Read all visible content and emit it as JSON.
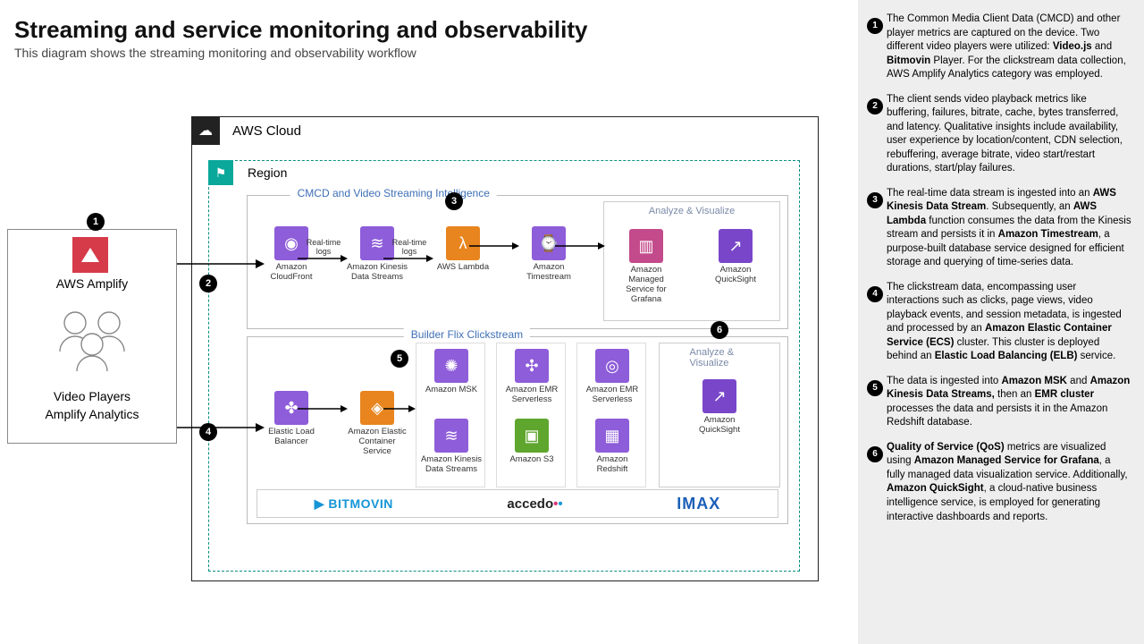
{
  "title": "Streaming and service monitoring and observability",
  "subtitle": "This diagram shows the streaming monitoring and observability workflow",
  "client": {
    "amplify": "AWS Amplify",
    "video_players": "Video Players",
    "amplify_analytics": "Amplify Analytics"
  },
  "aws_cloud": {
    "label": "AWS Cloud",
    "region_label": "Region",
    "section_cmcd": "CMCD and Video Streaming Intelligence",
    "section_builderflix": "Builder Flix Clickstream",
    "analyze_visualize": "Analyze & Visualize"
  },
  "services": {
    "cloudfront": "Amazon CloudFront",
    "kinesis": "Amazon Kinesis Data Streams",
    "lambda": "AWS Lambda",
    "timestream": "Amazon Timestream",
    "grafana": "Amazon Managed Service for Grafana",
    "quicksight": "Amazon QuickSight",
    "elb": "Elastic Load Balancer",
    "ecs": "Amazon Elastic Container Service",
    "msk": "Amazon MSK",
    "emr": "Amazon EMR Serverless",
    "s3": "Amazon S3",
    "redshift": "Amazon Redshift"
  },
  "arrow_labels": {
    "realtime_logs": "Real-time logs"
  },
  "partners": {
    "bitmovin": "BITMOVIN",
    "accedo": "accedo",
    "imax": "IMAX"
  },
  "notes": [
    {
      "num": "1",
      "html": "The Common Media Client Data (CMCD) and other player metrics are captured on the device. Two different video players were utilized: <b>Video.js</b> and <b>Bitmovin</b> Player. For the clickstream data collection, AWS Amplify Analytics category was employed."
    },
    {
      "num": "2",
      "html": "The client sends video playback metrics like buffering, failures, bitrate, cache, bytes transferred, and latency. Qualitative insights include availability, user experience by location/content, CDN selection, rebuffering, average bitrate, video start/restart durations, start/play failures."
    },
    {
      "num": "3",
      "html": "The real-time data stream is ingested into an <b>AWS Kinesis Data Stream</b>. Subsequently, an <b>AWS Lambda</b> function consumes the data from the Kinesis stream and persists it in <b>Amazon Timestream</b>, a purpose-built database service designed for efficient storage and querying of time-series data."
    },
    {
      "num": "4",
      "html": "The clickstream data, encompassing user interactions such as clicks, page views, video playback events, and session metadata, is ingested and processed by an <b>Amazon Elastic Container Service (ECS)</b> cluster. This cluster is deployed behind an <b>Elastic Load Balancing (ELB)</b> service."
    },
    {
      "num": "5",
      "html": "The data is ingested into <b>Amazon MSK</b> and <b>Amazon Kinesis Data Streams,</b> then an <b>EMR cluster</b> processes the data and persists it in the Amazon Redshift database."
    },
    {
      "num": "6",
      "html": "<b>Quality of Service (QoS)</b> metrics are visualized using <b>Amazon Managed Service for Grafana</b>, a fully managed data visualization service. Additionally, <b>Amazon QuickSight</b>, a cloud-native business intelligence service, is employed for generating interactive dashboards and reports."
    }
  ]
}
